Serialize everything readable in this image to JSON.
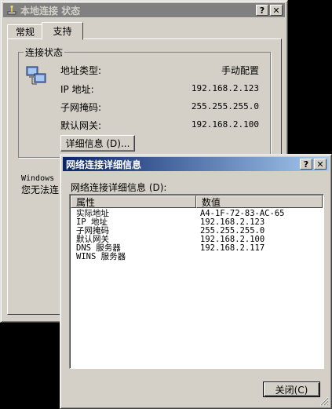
{
  "status_window": {
    "title": "本地连接 状态",
    "help_button": "?",
    "close_button": "✕",
    "tabs": [
      {
        "label": "常规"
      },
      {
        "label": "支持"
      }
    ],
    "group_title": "连接状态",
    "rows": [
      {
        "label": "地址类型:",
        "value": "手动配置"
      },
      {
        "label": "IP 地址:",
        "value": "192.168.2.123"
      },
      {
        "label": "子网掩码:",
        "value": "255.255.255.0"
      },
      {
        "label": "默认网关:",
        "value": "192.168.2.100"
      }
    ],
    "details_button": "详细信息 (D)...",
    "partial_text_1": "Windows",
    "partial_text_2": "您无法连"
  },
  "details_window": {
    "title": "网络连接详细信息",
    "help_button": "?",
    "close_button": "✕",
    "list_label": "网络连接详细信息 (D):",
    "columns": {
      "property": "属性",
      "value": "数值"
    },
    "rows": [
      {
        "property": "实际地址",
        "value": "A4-1F-72-83-AC-65"
      },
      {
        "property": "IP 地址",
        "value": "192.168.2.123"
      },
      {
        "property": "子网掩码",
        "value": "255.255.255.0"
      },
      {
        "property": "默认网关",
        "value": "192.168.2.100"
      },
      {
        "property": "DNS 服务器",
        "value": "192.168.2.117"
      },
      {
        "property": "WINS 服务器",
        "value": ""
      }
    ],
    "close_label": "关闭(C)"
  }
}
